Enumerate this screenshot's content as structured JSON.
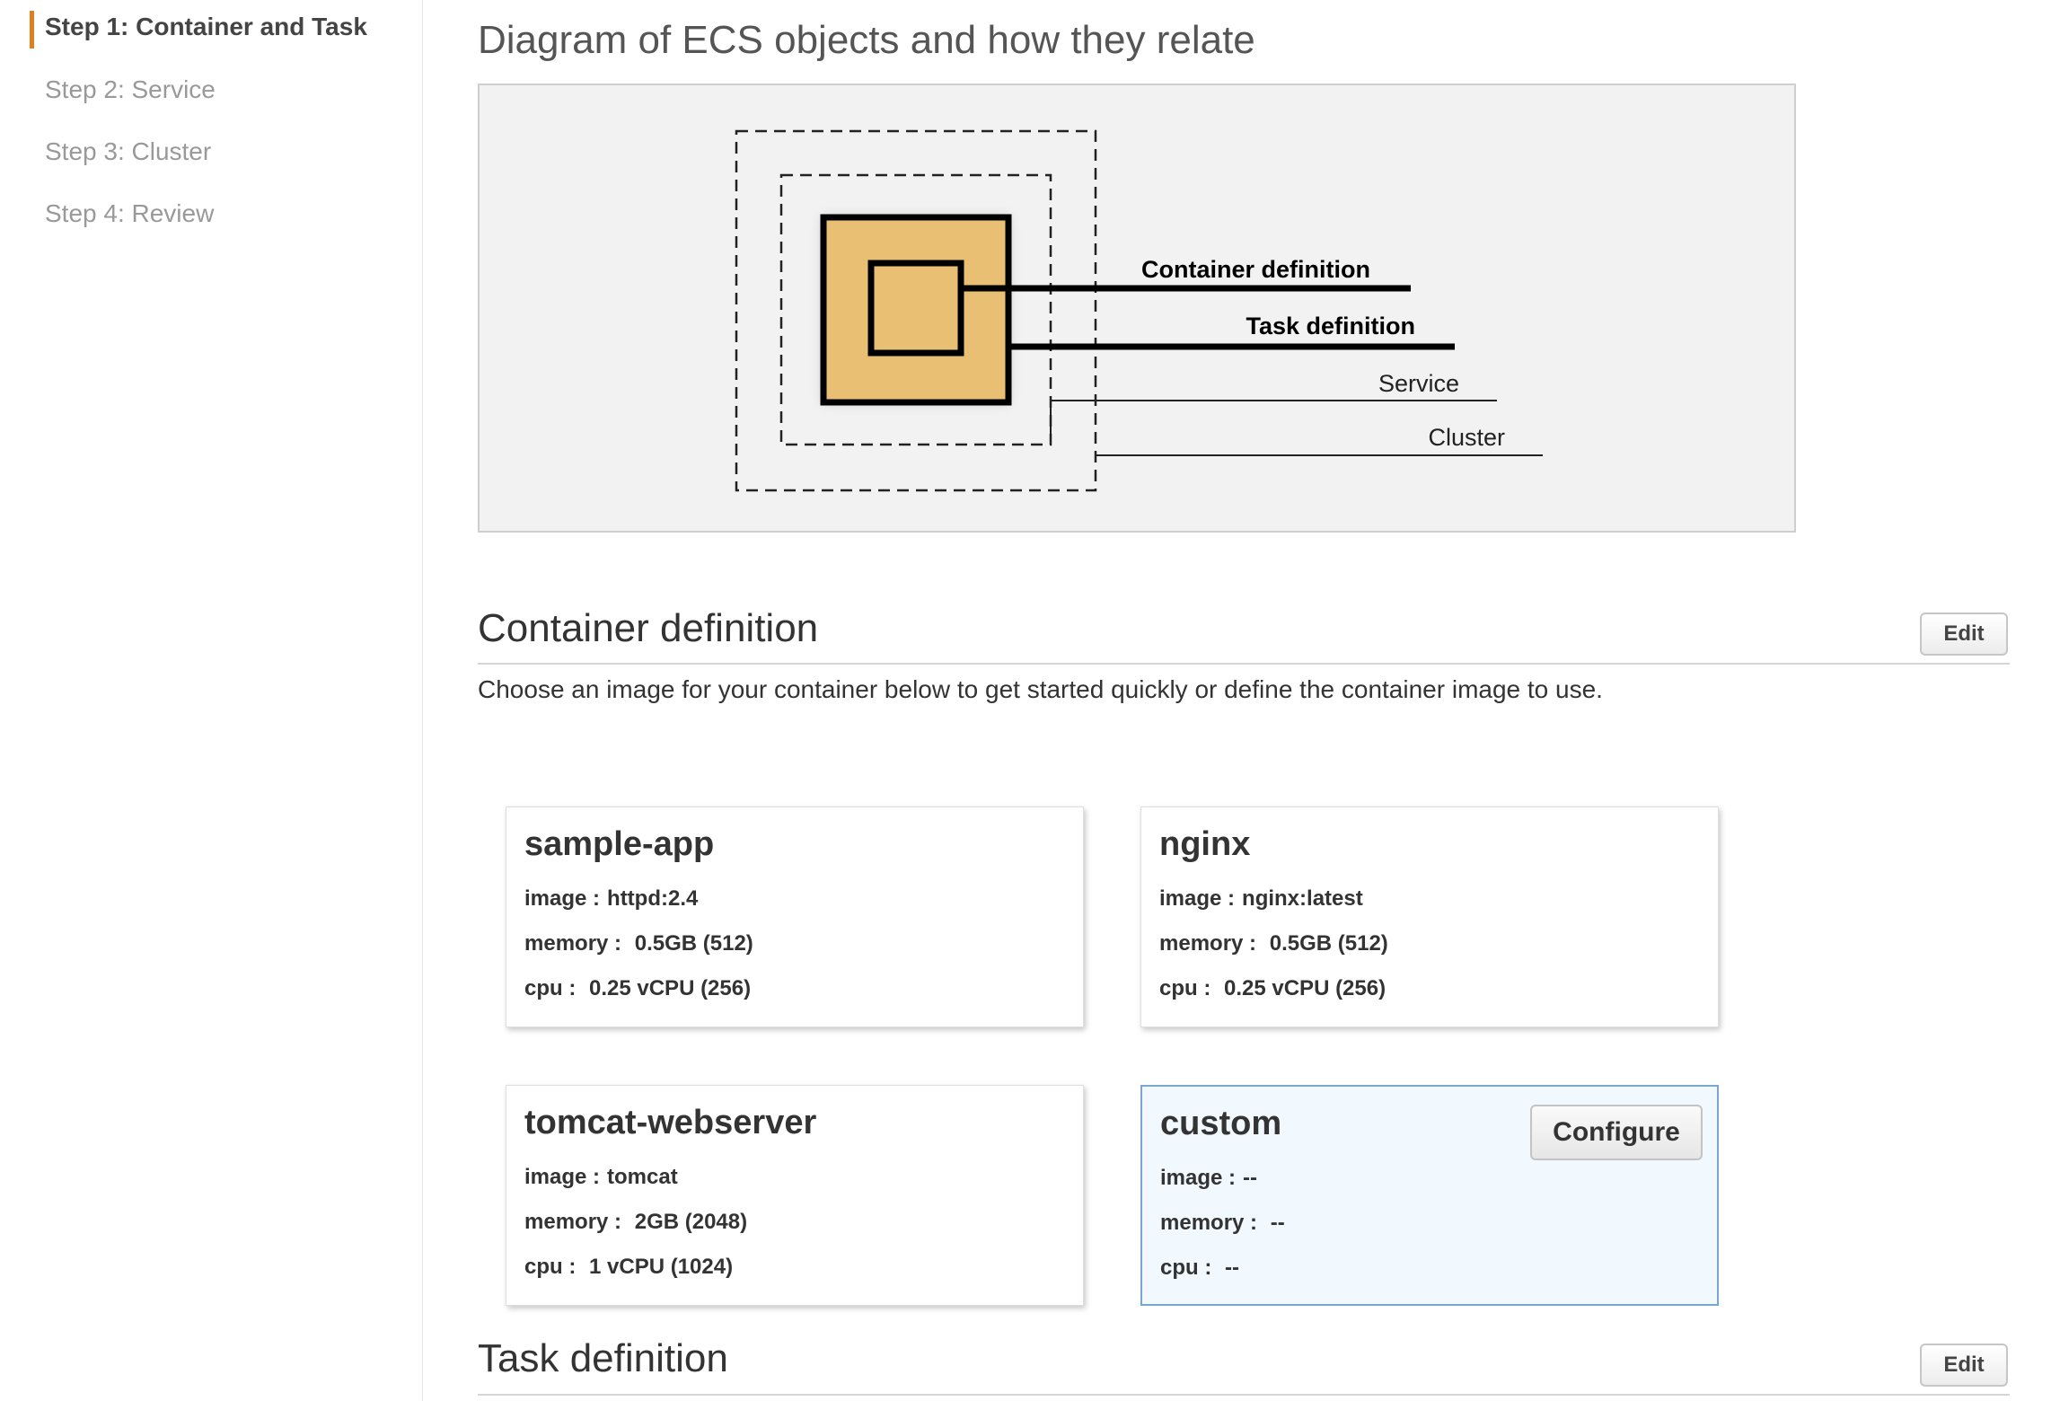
{
  "sidebar": {
    "steps": [
      {
        "label": "Step 1: Container and Task",
        "active": true
      },
      {
        "label": "Step 2: Service",
        "active": false
      },
      {
        "label": "Step 3: Cluster",
        "active": false
      },
      {
        "label": "Step 4: Review",
        "active": false
      }
    ]
  },
  "diagram": {
    "title": "Diagram of ECS objects and how they relate",
    "labels": {
      "container_definition": "Container definition",
      "task_definition": "Task definition",
      "service": "Service",
      "cluster": "Cluster"
    },
    "colors": {
      "fill": "#e9bf74",
      "background": "#f2f2f2"
    }
  },
  "container_section": {
    "title": "Container definition",
    "edit_label": "Edit",
    "intro": "Choose an image for your container below to get started quickly or define the container image to use.",
    "cards": [
      {
        "name": "sample-app",
        "image_label": "image :",
        "image": "httpd:2.4",
        "memory_label": "memory :",
        "memory": "0.5GB (512)",
        "cpu_label": "cpu :",
        "cpu": "0.25 vCPU (256)"
      },
      {
        "name": "nginx",
        "image_label": "image :",
        "image": "nginx:latest",
        "memory_label": "memory :",
        "memory": "0.5GB (512)",
        "cpu_label": "cpu :",
        "cpu": "0.25 vCPU (256)"
      },
      {
        "name": "tomcat-webserver",
        "image_label": "image :",
        "image": "tomcat",
        "memory_label": "memory :",
        "memory": "2GB (2048)",
        "cpu_label": "cpu :",
        "cpu": "1 vCPU (1024)"
      },
      {
        "name": "custom",
        "image_label": "image :",
        "image": "--",
        "memory_label": "memory :",
        "memory": "--",
        "cpu_label": "cpu :",
        "cpu": "--",
        "configure_label": "Configure",
        "selected": true
      }
    ]
  },
  "task_section": {
    "title": "Task definition",
    "edit_label": "Edit"
  },
  "colors": {
    "accent": "#e07f22",
    "selected_bg": "#f1f8fe",
    "selected_border": "#7aa7cf"
  }
}
